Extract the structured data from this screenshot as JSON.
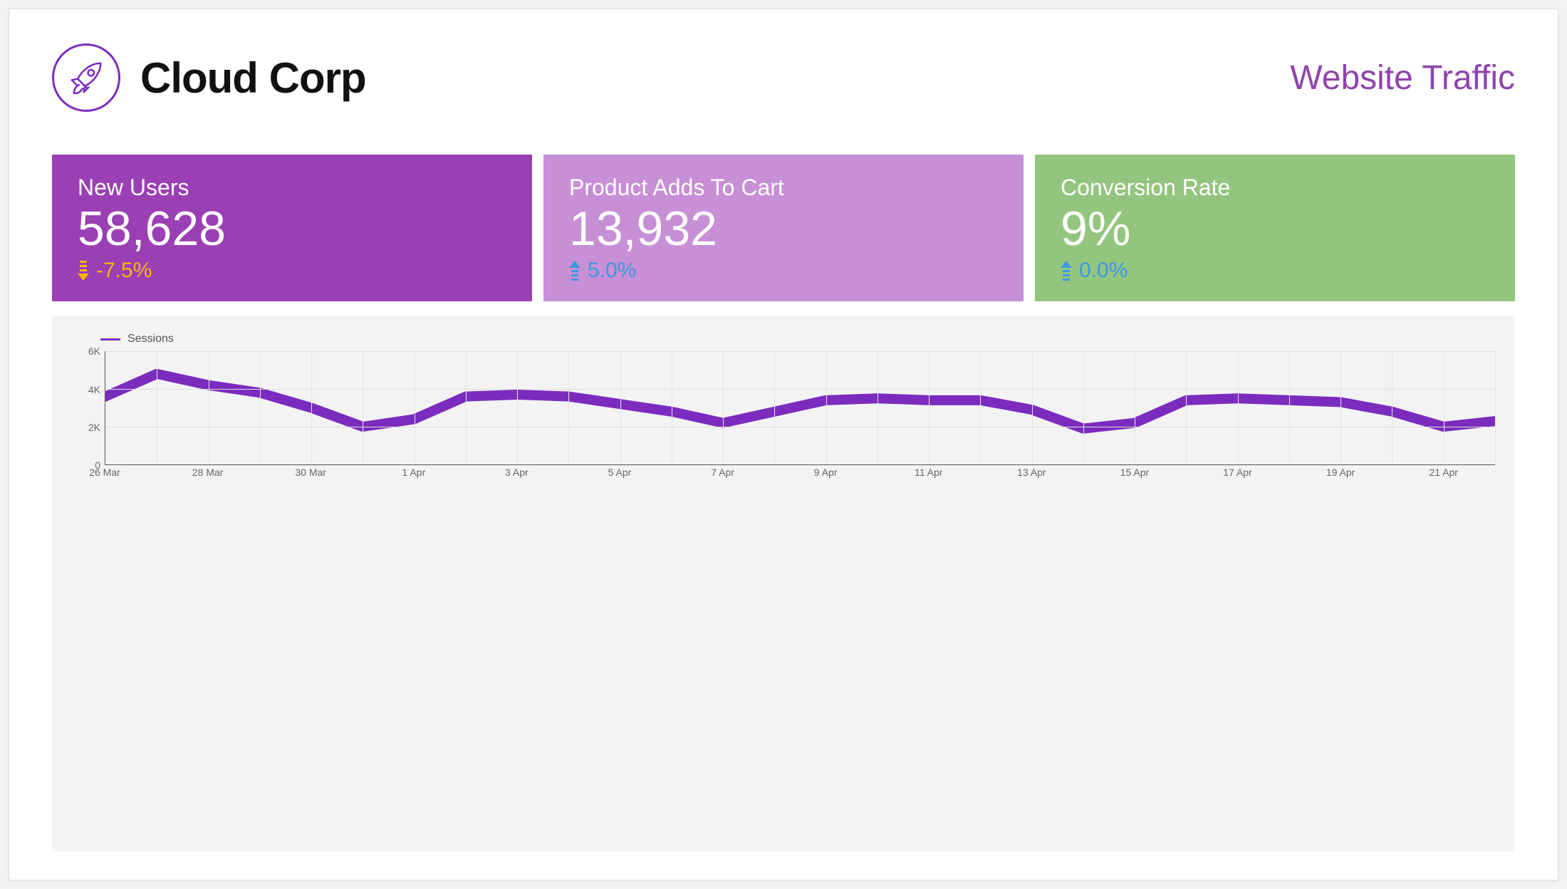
{
  "brand": {
    "name": "Cloud Corp"
  },
  "page_title": "Website Traffic",
  "kpis": [
    {
      "label": "New Users",
      "value": "58,628",
      "delta": "-7.5%",
      "dir": "down",
      "bg": "kpi-1"
    },
    {
      "label": "Product Adds To Cart",
      "value": "13,932",
      "delta": "5.0%",
      "dir": "up",
      "bg": "kpi-2"
    },
    {
      "label": "Conversion Rate",
      "value": "9%",
      "delta": "0.0%",
      "dir": "up",
      "bg": "kpi-3"
    }
  ],
  "chart_data": {
    "type": "line",
    "title": "",
    "legend": "Sessions",
    "ylabel": "",
    "xlabel": "",
    "ylim": [
      0,
      6000
    ],
    "y_ticks": [
      0,
      2000,
      4000,
      6000
    ],
    "y_tick_labels": [
      "0",
      "2K",
      "4K",
      "6K"
    ],
    "x_tick_labels": [
      "26 Mar",
      "28 Mar",
      "30 Mar",
      "1 Apr",
      "3 Apr",
      "5 Apr",
      "7 Apr",
      "9 Apr",
      "11 Apr",
      "13 Apr",
      "15 Apr",
      "17 Apr",
      "19 Apr",
      "21 Apr"
    ],
    "x": [
      "26 Mar",
      "27 Mar",
      "28 Mar",
      "29 Mar",
      "30 Mar",
      "31 Mar",
      "1 Apr",
      "2 Apr",
      "3 Apr",
      "4 Apr",
      "5 Apr",
      "6 Apr",
      "7 Apr",
      "8 Apr",
      "9 Apr",
      "10 Apr",
      "11 Apr",
      "12 Apr",
      "13 Apr",
      "14 Apr",
      "15 Apr",
      "16 Apr",
      "17 Apr",
      "18 Apr",
      "19 Apr",
      "20 Apr",
      "21 Apr",
      "22 Apr"
    ],
    "series": [
      {
        "name": "Sessions",
        "values": [
          3600,
          4800,
          4200,
          3800,
          3000,
          2000,
          2400,
          3600,
          3700,
          3600,
          3200,
          2800,
          2200,
          2800,
          3400,
          3500,
          3400,
          3400,
          2900,
          1900,
          2200,
          3400,
          3500,
          3400,
          3300,
          2800,
          2000,
          2300
        ],
        "color": "#7B2CBF"
      }
    ]
  }
}
